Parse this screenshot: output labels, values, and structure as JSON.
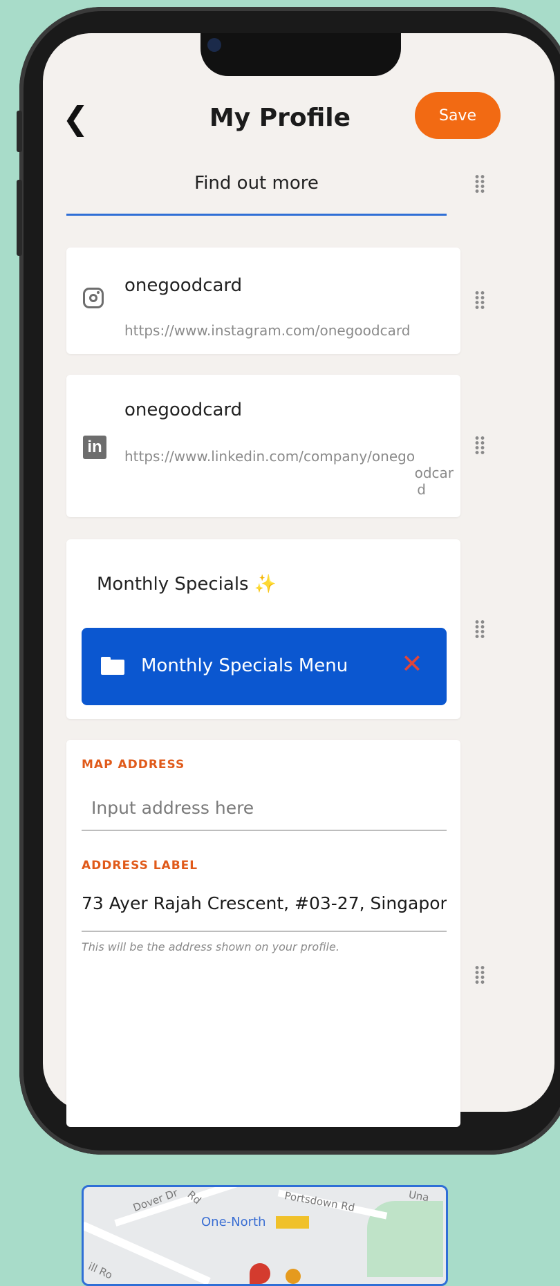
{
  "header": {
    "back_icon": "chevron-left-icon",
    "title": "My Profile",
    "save_label": "Save",
    "accent_color": "#f26a13"
  },
  "section_tab": {
    "label": "Find out more"
  },
  "links": [
    {
      "icon": "instagram-icon",
      "name": "onegoodcard",
      "url": "https://www.instagram.com/onegoodcard"
    },
    {
      "icon": "linkedin-icon",
      "name": "onegoodcard",
      "url_lines": [
        "https://www.linkedin.com/company/onego",
        "odcar",
        "d"
      ]
    }
  ],
  "specials": {
    "title": "Monthly Specials ✨",
    "file_label": "Monthly Specials Menu",
    "file_color": "#0b57d0"
  },
  "address": {
    "map_address_label": "MAP ADDRESS",
    "map_address_placeholder": "Input address here",
    "address_label_label": "ADDRESS LABEL",
    "address_value": "73 Ayer Rajah Crescent, #03-27, Singapor",
    "helper_text": "This will be the address shown on your profile."
  },
  "map": {
    "poi": "One-North",
    "street_1": "Dover Dr",
    "street_2": "Rd",
    "street_3": "Portsdown Rd",
    "street_4": "Una",
    "street_5": "ill Ro"
  }
}
